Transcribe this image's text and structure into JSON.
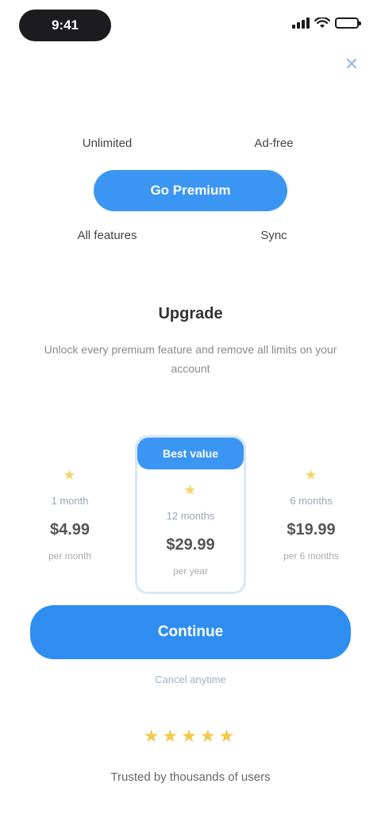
{
  "status_bar": {
    "time": "9:41"
  },
  "close": {
    "label": "✕"
  },
  "features": {
    "row1": [
      "Unlimited",
      "Ad-free"
    ],
    "hero": "Go Premium",
    "row2": [
      "All features",
      "Sync"
    ]
  },
  "title": "Upgrade",
  "subtitle": "Unlock every premium feature and remove all limits on your account",
  "plans": [
    {
      "stars": "★",
      "duration": "1 month",
      "price": "$4.99",
      "per": "per month"
    },
    {
      "badge": "Best value",
      "stars": "★",
      "duration": "12 months",
      "price": "$29.99",
      "per": "per year"
    },
    {
      "stars": "★",
      "duration": "6 months",
      "price": "$19.99",
      "per": "per 6 months"
    }
  ],
  "continue_label": "Continue",
  "cancel_note": "Cancel anytime",
  "rating": "★★★★★",
  "review": "Trusted by thousands of users"
}
